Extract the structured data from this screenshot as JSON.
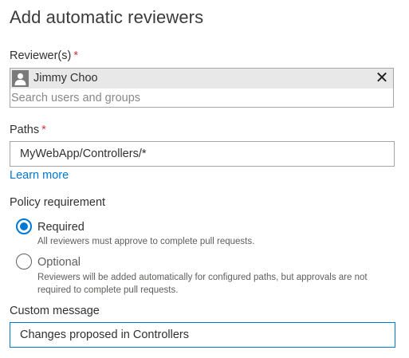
{
  "page_title": "Add automatic reviewers",
  "reviewers": {
    "label": "Reviewer(s)",
    "required_mark": "*",
    "selected": [
      {
        "name": "Jimmy Choo",
        "avatar_icon": "user-icon",
        "remove_icon": "close-icon",
        "remove_glyph": "✕"
      }
    ],
    "search_placeholder": "Search users and groups",
    "search_value": ""
  },
  "paths": {
    "label": "Paths",
    "required_mark": "*",
    "value": "MyWebApp/Controllers/*",
    "learn_more": "Learn more"
  },
  "policy": {
    "label": "Policy requirement",
    "options": [
      {
        "label": "Required",
        "description": "All reviewers must approve to complete pull requests.",
        "selected": true
      },
      {
        "label": "Optional",
        "description_line1": "Reviewers will be added automatically for configured paths, but approvals are not",
        "description_line2": "required to complete pull requests.",
        "selected": false
      }
    ]
  },
  "custom_message": {
    "label": "Custom message",
    "value": "Changes proposed in Controllers"
  },
  "colors": {
    "accent": "#0078d4",
    "required": "#d13438",
    "chip_bg": "#e8e8e8",
    "border": "#a6a6a6"
  }
}
